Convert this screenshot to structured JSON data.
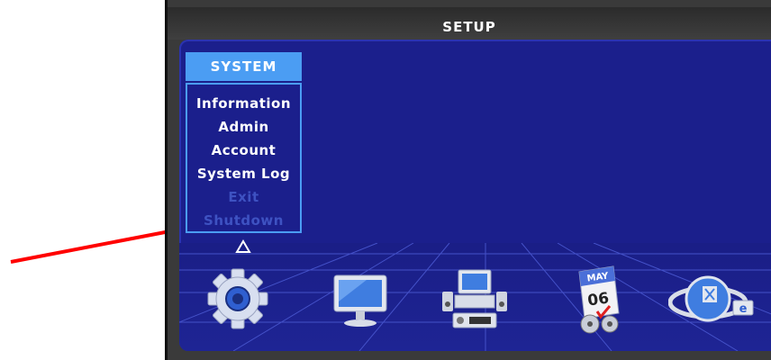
{
  "window": {
    "title": "SETUP"
  },
  "menu": {
    "header": "SYSTEM",
    "items": [
      {
        "label": "Information",
        "enabled": true
      },
      {
        "label": "Admin",
        "enabled": true
      },
      {
        "label": "Account",
        "enabled": true
      },
      {
        "label": "System Log",
        "enabled": true
      },
      {
        "label": "Exit",
        "enabled": false
      },
      {
        "label": "Shutdown",
        "enabled": false
      }
    ],
    "scroll_up_icon": "triangle-up-icon"
  },
  "dock": {
    "icons": [
      {
        "name": "gear-icon"
      },
      {
        "name": "monitor-icon"
      },
      {
        "name": "computer-devices-icon"
      },
      {
        "name": "calendar-icon",
        "month": "MAY",
        "day": "06"
      },
      {
        "name": "network-globe-icon",
        "badge": "e"
      }
    ]
  },
  "annotation": {
    "arrow_color": "#ff0000"
  },
  "colors": {
    "panel_bg": "#1b1f8c",
    "accent": "#4b9df3",
    "disabled_text": "#3e52c2"
  }
}
